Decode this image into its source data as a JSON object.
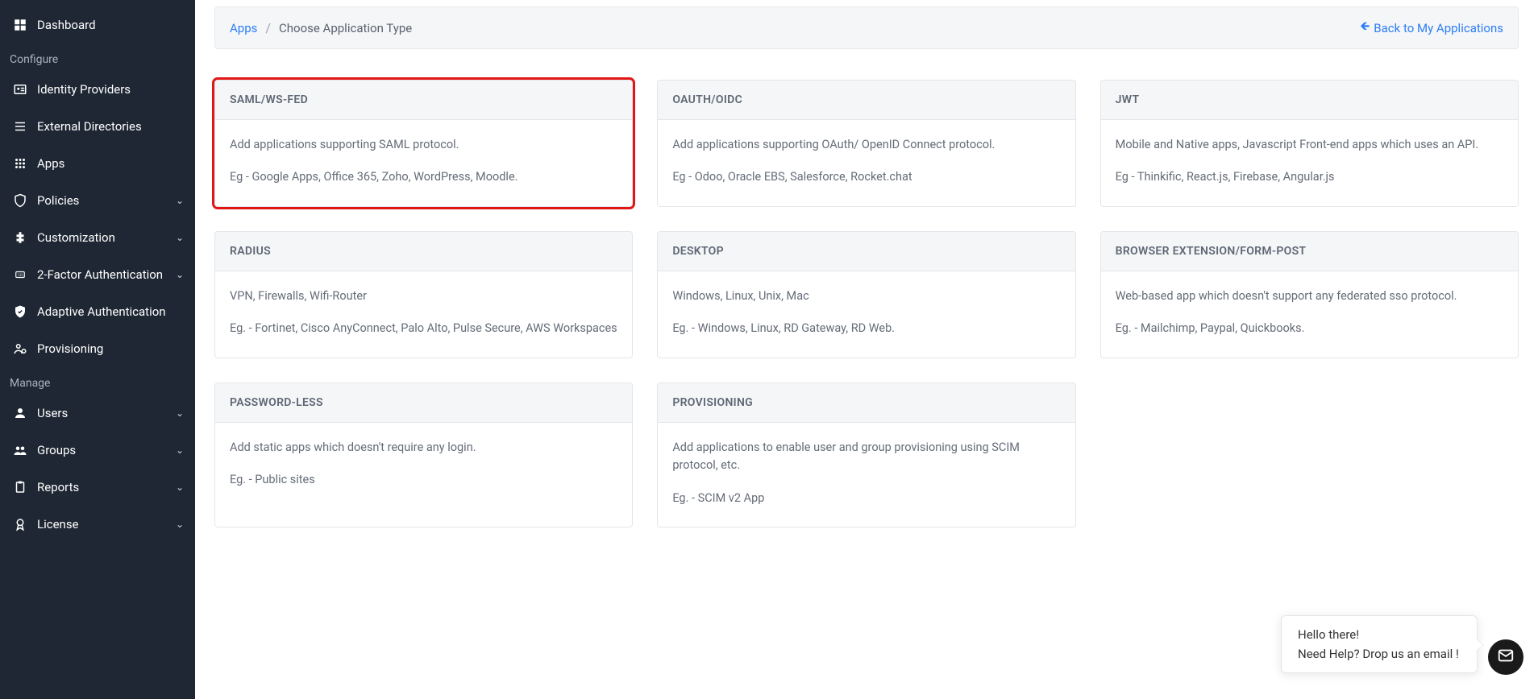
{
  "sidebar": {
    "dashboard": "Dashboard",
    "sections": {
      "configure": "Configure",
      "manage": "Manage"
    },
    "identity_providers": "Identity Providers",
    "external_directories": "External Directories",
    "apps": "Apps",
    "policies": "Policies",
    "customization": "Customization",
    "two_factor": "2-Factor Authentication",
    "adaptive_auth": "Adaptive Authentication",
    "provisioning": "Provisioning",
    "users": "Users",
    "groups": "Groups",
    "reports": "Reports",
    "license": "License"
  },
  "breadcrumb": {
    "apps": "Apps",
    "current": "Choose Application Type",
    "back": "Back to My Applications"
  },
  "cards": {
    "saml": {
      "title": "SAML/WS-FED",
      "desc": "Add applications supporting SAML protocol.",
      "eg": "Eg - Google Apps, Office 365, Zoho, WordPress, Moodle."
    },
    "oauth": {
      "title": "OAUTH/OIDC",
      "desc": "Add applications supporting OAuth/ OpenID Connect protocol.",
      "eg": "Eg - Odoo, Oracle EBS, Salesforce, Rocket.chat"
    },
    "jwt": {
      "title": "JWT",
      "desc": "Mobile and Native apps, Javascript Front-end apps which uses an API.",
      "eg": "Eg - Thinkific, React.js, Firebase, Angular.js"
    },
    "radius": {
      "title": "RADIUS",
      "desc": "VPN, Firewalls, Wifi-Router",
      "eg": "Eg. - Fortinet, Cisco AnyConnect, Palo Alto, Pulse Secure, AWS Workspaces"
    },
    "desktop": {
      "title": "DESKTOP",
      "desc": "Windows, Linux, Unix, Mac",
      "eg": "Eg. - Windows, Linux, RD Gateway, RD Web."
    },
    "browser": {
      "title": "BROWSER EXTENSION/FORM-POST",
      "desc": "Web-based app which doesn't support any federated sso protocol.",
      "eg": "Eg. - Mailchimp, Paypal, Quickbooks."
    },
    "passwordless": {
      "title": "PASSWORD-LESS",
      "desc": "Add static apps which doesn't require any login.",
      "eg": "Eg. - Public sites"
    },
    "prov": {
      "title": "PROVISIONING",
      "desc": "Add applications to enable user and group provisioning using SCIM protocol, etc.",
      "eg": "Eg. - SCIM v2 App"
    }
  },
  "chat": {
    "line1": "Hello there!",
    "line2": "Need Help? Drop us an email !"
  }
}
